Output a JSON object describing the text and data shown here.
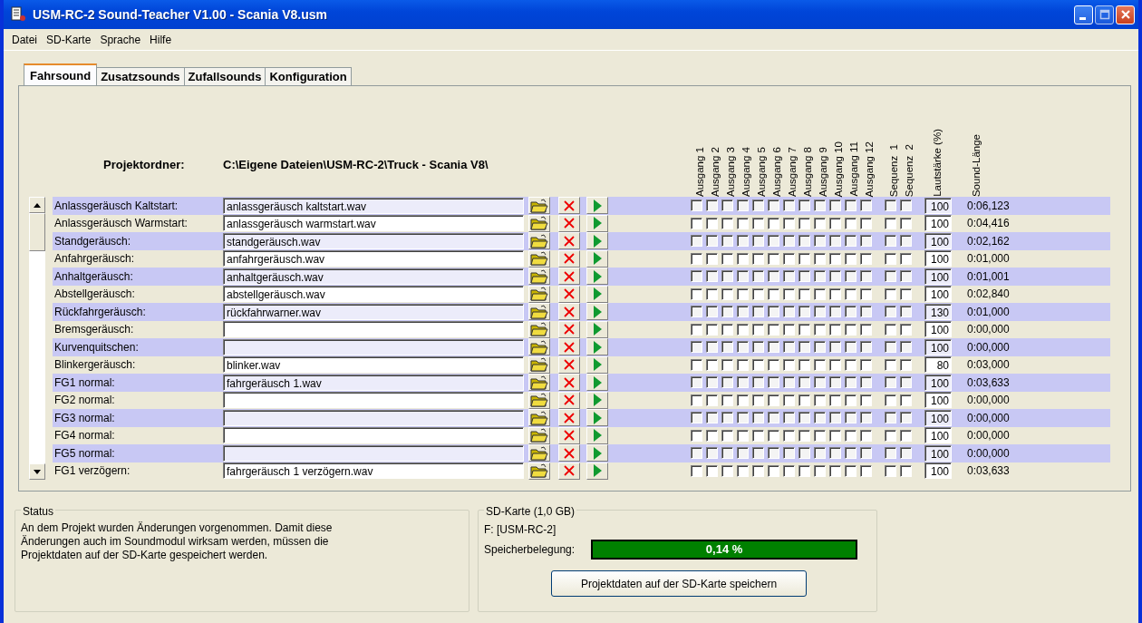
{
  "window": {
    "title": "USM-RC-2 Sound-Teacher V1.00 - Scania V8.usm"
  },
  "menu": [
    "Datei",
    "SD-Karte",
    "Sprache",
    "Hilfe"
  ],
  "tabs": [
    {
      "label": "Fahrsound",
      "selected": true
    },
    {
      "label": "Zusatzsounds",
      "selected": false
    },
    {
      "label": "Zufallsounds",
      "selected": false
    },
    {
      "label": "Konfiguration",
      "selected": false
    }
  ],
  "project_folder": {
    "label": "Projektordner:",
    "path": "C:\\Eigene Dateien\\USM-RC-2\\Truck - Scania V8\\"
  },
  "output_headers": [
    "Ausgang 1",
    "Ausgang 2",
    "Ausgang 3",
    "Ausgang 4",
    "Ausgang 5",
    "Ausgang 6",
    "Ausgang 7",
    "Ausgang 8",
    "Ausgang 9",
    "Ausgang 10",
    "Ausgang 11",
    "Ausgang 12"
  ],
  "sequence_headers": [
    "Sequenz  1",
    "Sequenz  2"
  ],
  "volume_header": "Lautstärke (%)",
  "length_header": "Sound-Länge",
  "rows": [
    {
      "name": "Anlassgeräusch Kaltstart:",
      "file": "anlassgeräusch kaltstart.wav",
      "outputs": [
        false,
        false,
        false,
        false,
        false,
        false,
        false,
        false,
        false,
        false,
        false,
        false
      ],
      "sequences": [
        false,
        false
      ],
      "volume": "100",
      "length": "0:06,123"
    },
    {
      "name": "Anlassgeräusch Warmstart:",
      "file": "anlassgeräusch warmstart.wav",
      "outputs": [
        false,
        false,
        false,
        false,
        false,
        false,
        false,
        false,
        false,
        false,
        false,
        false
      ],
      "sequences": [
        false,
        false
      ],
      "volume": "100",
      "length": "0:04,416"
    },
    {
      "name": "Standgeräusch:",
      "file": "standgeräusch.wav",
      "outputs": [
        false,
        false,
        false,
        false,
        false,
        false,
        false,
        false,
        false,
        false,
        false,
        false
      ],
      "sequences": [
        false,
        false
      ],
      "volume": "100",
      "length": "0:02,162"
    },
    {
      "name": "Anfahrgeräusch:",
      "file": "anfahrgeräusch.wav",
      "outputs": [
        false,
        false,
        false,
        false,
        false,
        false,
        false,
        false,
        false,
        false,
        false,
        false
      ],
      "sequences": [
        false,
        false
      ],
      "volume": "100",
      "length": "0:01,000"
    },
    {
      "name": "Anhaltgeräusch:",
      "file": "anhaltgeräusch.wav",
      "outputs": [
        false,
        false,
        false,
        false,
        false,
        false,
        false,
        false,
        false,
        false,
        false,
        false
      ],
      "sequences": [
        false,
        false
      ],
      "volume": "100",
      "length": "0:01,001"
    },
    {
      "name": "Abstellgeräusch:",
      "file": "abstellgeräusch.wav",
      "outputs": [
        false,
        false,
        false,
        false,
        false,
        false,
        false,
        false,
        false,
        false,
        false,
        false
      ],
      "sequences": [
        false,
        false
      ],
      "volume": "100",
      "length": "0:02,840"
    },
    {
      "name": "Rückfahrgeräusch:",
      "file": "rückfahrwarner.wav",
      "outputs": [
        false,
        false,
        false,
        false,
        false,
        false,
        false,
        false,
        false,
        false,
        false,
        false
      ],
      "sequences": [
        false,
        false
      ],
      "volume": "130",
      "length": "0:01,000"
    },
    {
      "name": "Bremsgeräusch:",
      "outputs": [
        false,
        false,
        false,
        false,
        false,
        false,
        false,
        false,
        false,
        false,
        false,
        false
      ],
      "sequences": [
        false,
        false
      ],
      "volume": "100",
      "length": "0:00,000"
    },
    {
      "name": "Kurvenquitschen:",
      "outputs": [
        false,
        false,
        false,
        false,
        false,
        false,
        false,
        false,
        false,
        false,
        false,
        false
      ],
      "sequences": [
        false,
        false
      ],
      "volume": "100",
      "length": "0:00,000"
    },
    {
      "name": "Blinkergeräusch:",
      "file": "blinker.wav",
      "outputs": [
        false,
        false,
        false,
        false,
        false,
        false,
        false,
        false,
        false,
        false,
        false,
        false
      ],
      "sequences": [
        false,
        false
      ],
      "volume": "80",
      "length": "0:03,000"
    },
    {
      "name": "FG1 normal:",
      "file": "fahrgeräusch 1.wav",
      "outputs": [
        false,
        false,
        false,
        false,
        false,
        false,
        false,
        false,
        false,
        false,
        false,
        false
      ],
      "sequences": [
        false,
        false
      ],
      "volume": "100",
      "length": "0:03,633"
    },
    {
      "name": "FG2 normal:",
      "outputs": [
        false,
        false,
        false,
        false,
        false,
        false,
        false,
        false,
        false,
        false,
        false,
        false
      ],
      "sequences": [
        false,
        false
      ],
      "volume": "100",
      "length": "0:00,000"
    },
    {
      "name": "FG3 normal:",
      "outputs": [
        false,
        false,
        false,
        false,
        false,
        false,
        false,
        false,
        false,
        false,
        false,
        false
      ],
      "sequences": [
        false,
        false
      ],
      "volume": "100",
      "length": "0:00,000"
    },
    {
      "name": "FG4 normal:",
      "outputs": [
        false,
        false,
        false,
        false,
        false,
        false,
        false,
        false,
        false,
        false,
        false,
        false
      ],
      "sequences": [
        false,
        false
      ],
      "volume": "100",
      "length": "0:00,000"
    },
    {
      "name": "FG5 normal:",
      "outputs": [
        false,
        false,
        false,
        false,
        false,
        false,
        false,
        false,
        false,
        false,
        false,
        false
      ],
      "sequences": [
        false,
        false
      ],
      "volume": "100",
      "length": "0:00,000"
    },
    {
      "name": "FG1 verzögern:",
      "file": "fahrgeräusch 1 verzögern.wav",
      "outputs": [
        false,
        false,
        false,
        false,
        false,
        false,
        false,
        false,
        false,
        false,
        false,
        false
      ],
      "sequences": [
        false,
        false
      ],
      "volume": "100",
      "length": "0:03,633"
    }
  ],
  "status": {
    "title": "Status",
    "text": "An dem Projekt wurden Änderungen vorgenommen. Damit diese Änderungen auch im Soundmodul wirksam werden, müssen die Projektdaten auf der SD-Karte gespeichert werden."
  },
  "sd_card": {
    "title": "SD-Karte (1,0 GB)",
    "drive": "F: [USM-RC-2]",
    "usage_label": "Speicherbelegung:",
    "usage": {
      "level": 1,
      "reading": "0,14 %"
    },
    "save_button": "Projektdaten auf der SD-Karte speichern"
  }
}
